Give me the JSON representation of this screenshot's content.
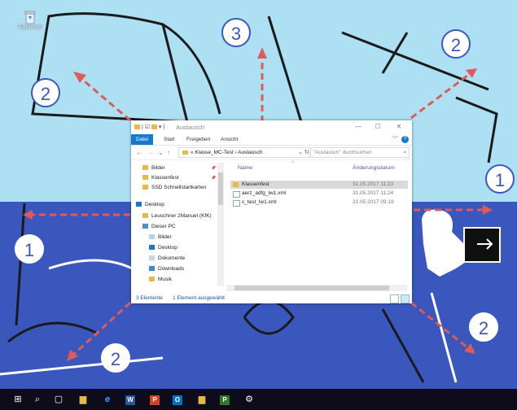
{
  "desktop": {
    "recycle_bin_label": "Papierkorb"
  },
  "badges": [
    "2",
    "3",
    "2",
    "1",
    "1",
    "2",
    "2"
  ],
  "window": {
    "title": "Austausch",
    "controls": {
      "minimize": "—",
      "maximize": "☐",
      "close": "✕"
    },
    "ribbon_tabs": [
      "Datei",
      "Start",
      "Freigeben",
      "Ansicht"
    ],
    "address_path": "« Klasse_MC-Test › Austausch",
    "search_placeholder": "\"Austausch\" durchsuchen",
    "nav_items": [
      "Bilder",
      "Klassenfest",
      "SSD Schnellstartkarten",
      "Desktop",
      "Leuschner 2Manuel (KfK)",
      "Dieser PC",
      "Bilder",
      "Desktop",
      "Dokumente",
      "Downloads",
      "Musik"
    ],
    "columns": {
      "name": "Name",
      "date": "Änderungsdatum"
    },
    "files": [
      {
        "name": "Klassenfest",
        "date": "31.05.2017 11:23",
        "icon": "folder-icon"
      },
      {
        "name": "aerz_adfg_lw1.xml",
        "date": "31.05.2017 11:24",
        "icon": "xml-file-icon"
      },
      {
        "name": "c_test_lw1.xml",
        "date": "31.05.2017 09:19",
        "icon": "xml-file-icon"
      }
    ],
    "status": {
      "count": "3 Elemente",
      "selected": "1 Element ausgewählt"
    }
  },
  "colors": {
    "accent": "#1979ca",
    "desktop_top": "#aee0f3",
    "desktop_bottom": "#3a57bd",
    "arrow": "#e05a5a"
  },
  "taskbar_icons": [
    "windows-start-icon",
    "search-icon",
    "task-view-icon",
    "file-explorer-icon",
    "edge-icon",
    "word-icon",
    "powerpoint-icon",
    "outlook-icon",
    "folder-icon",
    "project-icon",
    "settings-icon"
  ]
}
